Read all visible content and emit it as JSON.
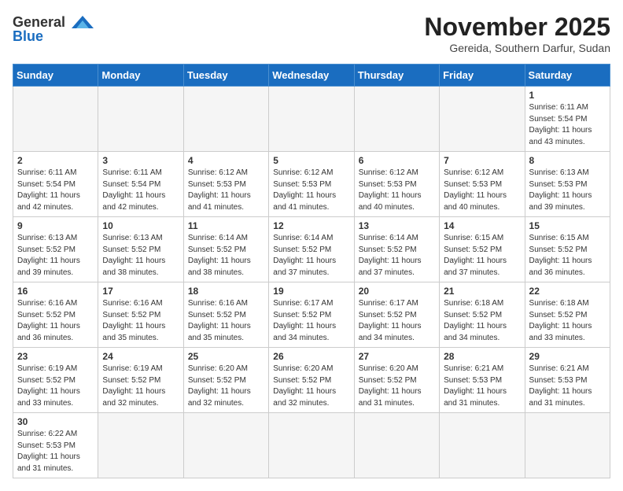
{
  "header": {
    "logo_line1": "General",
    "logo_line2": "Blue",
    "month": "November 2025",
    "location": "Gereida, Southern Darfur, Sudan"
  },
  "weekdays": [
    "Sunday",
    "Monday",
    "Tuesday",
    "Wednesday",
    "Thursday",
    "Friday",
    "Saturday"
  ],
  "weeks": [
    [
      {
        "day": "",
        "info": ""
      },
      {
        "day": "",
        "info": ""
      },
      {
        "day": "",
        "info": ""
      },
      {
        "day": "",
        "info": ""
      },
      {
        "day": "",
        "info": ""
      },
      {
        "day": "",
        "info": ""
      },
      {
        "day": "1",
        "info": "Sunrise: 6:11 AM\nSunset: 5:54 PM\nDaylight: 11 hours and 43 minutes."
      }
    ],
    [
      {
        "day": "2",
        "info": "Sunrise: 6:11 AM\nSunset: 5:54 PM\nDaylight: 11 hours and 42 minutes."
      },
      {
        "day": "3",
        "info": "Sunrise: 6:11 AM\nSunset: 5:54 PM\nDaylight: 11 hours and 42 minutes."
      },
      {
        "day": "4",
        "info": "Sunrise: 6:12 AM\nSunset: 5:53 PM\nDaylight: 11 hours and 41 minutes."
      },
      {
        "day": "5",
        "info": "Sunrise: 6:12 AM\nSunset: 5:53 PM\nDaylight: 11 hours and 41 minutes."
      },
      {
        "day": "6",
        "info": "Sunrise: 6:12 AM\nSunset: 5:53 PM\nDaylight: 11 hours and 40 minutes."
      },
      {
        "day": "7",
        "info": "Sunrise: 6:12 AM\nSunset: 5:53 PM\nDaylight: 11 hours and 40 minutes."
      },
      {
        "day": "8",
        "info": "Sunrise: 6:13 AM\nSunset: 5:53 PM\nDaylight: 11 hours and 39 minutes."
      }
    ],
    [
      {
        "day": "9",
        "info": "Sunrise: 6:13 AM\nSunset: 5:52 PM\nDaylight: 11 hours and 39 minutes."
      },
      {
        "day": "10",
        "info": "Sunrise: 6:13 AM\nSunset: 5:52 PM\nDaylight: 11 hours and 38 minutes."
      },
      {
        "day": "11",
        "info": "Sunrise: 6:14 AM\nSunset: 5:52 PM\nDaylight: 11 hours and 38 minutes."
      },
      {
        "day": "12",
        "info": "Sunrise: 6:14 AM\nSunset: 5:52 PM\nDaylight: 11 hours and 37 minutes."
      },
      {
        "day": "13",
        "info": "Sunrise: 6:14 AM\nSunset: 5:52 PM\nDaylight: 11 hours and 37 minutes."
      },
      {
        "day": "14",
        "info": "Sunrise: 6:15 AM\nSunset: 5:52 PM\nDaylight: 11 hours and 37 minutes."
      },
      {
        "day": "15",
        "info": "Sunrise: 6:15 AM\nSunset: 5:52 PM\nDaylight: 11 hours and 36 minutes."
      }
    ],
    [
      {
        "day": "16",
        "info": "Sunrise: 6:16 AM\nSunset: 5:52 PM\nDaylight: 11 hours and 36 minutes."
      },
      {
        "day": "17",
        "info": "Sunrise: 6:16 AM\nSunset: 5:52 PM\nDaylight: 11 hours and 35 minutes."
      },
      {
        "day": "18",
        "info": "Sunrise: 6:16 AM\nSunset: 5:52 PM\nDaylight: 11 hours and 35 minutes."
      },
      {
        "day": "19",
        "info": "Sunrise: 6:17 AM\nSunset: 5:52 PM\nDaylight: 11 hours and 34 minutes."
      },
      {
        "day": "20",
        "info": "Sunrise: 6:17 AM\nSunset: 5:52 PM\nDaylight: 11 hours and 34 minutes."
      },
      {
        "day": "21",
        "info": "Sunrise: 6:18 AM\nSunset: 5:52 PM\nDaylight: 11 hours and 34 minutes."
      },
      {
        "day": "22",
        "info": "Sunrise: 6:18 AM\nSunset: 5:52 PM\nDaylight: 11 hours and 33 minutes."
      }
    ],
    [
      {
        "day": "23",
        "info": "Sunrise: 6:19 AM\nSunset: 5:52 PM\nDaylight: 11 hours and 33 minutes."
      },
      {
        "day": "24",
        "info": "Sunrise: 6:19 AM\nSunset: 5:52 PM\nDaylight: 11 hours and 32 minutes."
      },
      {
        "day": "25",
        "info": "Sunrise: 6:20 AM\nSunset: 5:52 PM\nDaylight: 11 hours and 32 minutes."
      },
      {
        "day": "26",
        "info": "Sunrise: 6:20 AM\nSunset: 5:52 PM\nDaylight: 11 hours and 32 minutes."
      },
      {
        "day": "27",
        "info": "Sunrise: 6:20 AM\nSunset: 5:52 PM\nDaylight: 11 hours and 31 minutes."
      },
      {
        "day": "28",
        "info": "Sunrise: 6:21 AM\nSunset: 5:53 PM\nDaylight: 11 hours and 31 minutes."
      },
      {
        "day": "29",
        "info": "Sunrise: 6:21 AM\nSunset: 5:53 PM\nDaylight: 11 hours and 31 minutes."
      }
    ],
    [
      {
        "day": "30",
        "info": "Sunrise: 6:22 AM\nSunset: 5:53 PM\nDaylight: 11 hours and 31 minutes."
      },
      {
        "day": "",
        "info": ""
      },
      {
        "day": "",
        "info": ""
      },
      {
        "day": "",
        "info": ""
      },
      {
        "day": "",
        "info": ""
      },
      {
        "day": "",
        "info": ""
      },
      {
        "day": "",
        "info": ""
      }
    ]
  ]
}
